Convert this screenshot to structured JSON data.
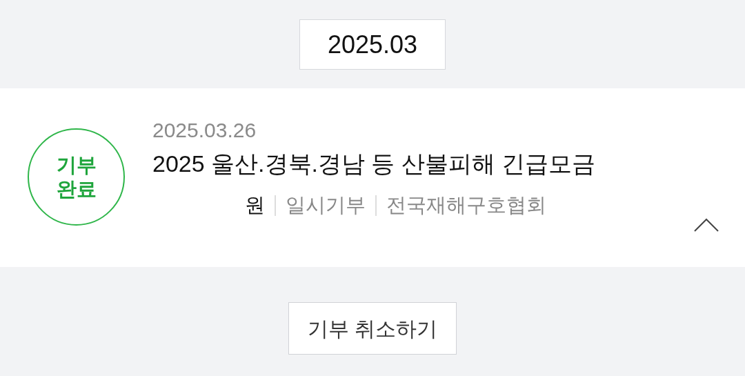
{
  "month": "2025.03",
  "donation": {
    "status_lines": [
      "기부",
      "완료"
    ],
    "date": "2025.03.26",
    "title": "2025 울산.경북.경남 등 산불피해 긴급모금",
    "amount": "원",
    "type": "일시기부",
    "organization": "전국재해구호협회",
    "expanded": true
  },
  "cancel_button": "기부 취소하기"
}
